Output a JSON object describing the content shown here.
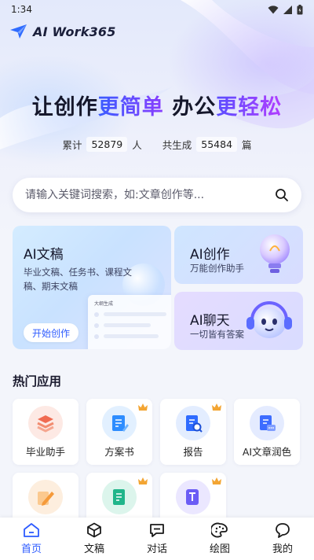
{
  "status_bar": {
    "time": "1:34"
  },
  "app": {
    "title": "AI Work365"
  },
  "hero": {
    "slogan_part1": "让创作",
    "slogan_part2": "更简单",
    "slogan_part3": " 办公",
    "slogan_part4": "更轻松",
    "stats": {
      "label_total": "累计",
      "total_users": "52879",
      "unit_users": "人",
      "label_generated": "共生成",
      "total_generated": "55484",
      "unit_generated": "篇"
    }
  },
  "search": {
    "placeholder": "请输入关键词搜索，如:文章创作等..."
  },
  "feature_cards": {
    "doc": {
      "title": "AI文稿",
      "desc": "毕业文稿、任务书、课程文稿、期末文稿",
      "button": "开始创作",
      "mock_title": "大纲生成"
    },
    "create": {
      "title": "AI创作",
      "desc": "万能创作助手"
    },
    "chat": {
      "title": "AI聊天",
      "desc": "一切皆有答案"
    }
  },
  "hot_apps": {
    "title": "热门应用",
    "items": [
      {
        "label": "毕业助手",
        "icon": "stack-books-icon",
        "color": "#f06a50",
        "premium": false
      },
      {
        "label": "方案书",
        "icon": "document-pen-icon",
        "color": "#2e8dff",
        "premium": true
      },
      {
        "label": "报告",
        "icon": "report-search-icon",
        "color": "#2e6bff",
        "premium": true
      },
      {
        "label": "AI文章润色",
        "icon": "document-chat-icon",
        "color": "#3d6cff",
        "premium": false
      },
      {
        "label": "",
        "icon": "write-pencil-icon",
        "color": "#f59a3a",
        "premium": false
      },
      {
        "label": "",
        "icon": "document-lines-icon",
        "color": "#20b58a",
        "premium": true
      },
      {
        "label": "",
        "icon": "text-format-icon",
        "color": "#6b5cf5",
        "premium": true
      }
    ]
  },
  "tabbar": {
    "items": [
      {
        "label": "首页",
        "icon": "home-icon",
        "active": true
      },
      {
        "label": "文稿",
        "icon": "cube-icon",
        "active": false
      },
      {
        "label": "对话",
        "icon": "chat-icon",
        "active": false
      },
      {
        "label": "绘图",
        "icon": "palette-icon",
        "active": false
      },
      {
        "label": "我的",
        "icon": "profile-icon",
        "active": false
      }
    ]
  }
}
